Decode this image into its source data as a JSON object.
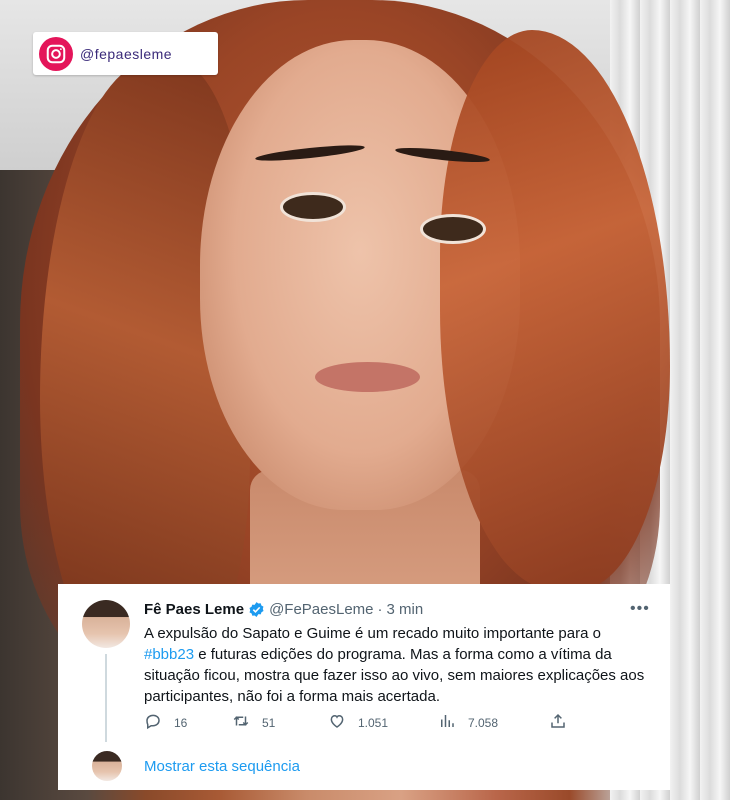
{
  "instagram": {
    "handle": "@fepaesleme",
    "icon": "instagram-icon",
    "accent": "#e4155a"
  },
  "tweet": {
    "author_name": "Fê Paes Leme",
    "handle": "@FePaesLeme",
    "separator": "·",
    "time": "3 min",
    "more_icon": "ellipsis-icon",
    "verified_color": "#1d9bf0",
    "text_before": "A expulsão do Sapato e Guime é um recado muito importante para o ",
    "hashtag": "#bbb23",
    "text_after": " e futuras edições do programa. Mas a forma como a vítima da situação ficou, mostra que fazer isso ao vivo, sem maiores explicações aos participantes, não foi a forma mais acertada.",
    "actions": {
      "reply_count": "16",
      "retweet_count": "51",
      "like_count": "1.051",
      "views_count": "7.058"
    },
    "show_thread_label": "Mostrar esta sequência",
    "link_color": "#1d9bf0"
  }
}
